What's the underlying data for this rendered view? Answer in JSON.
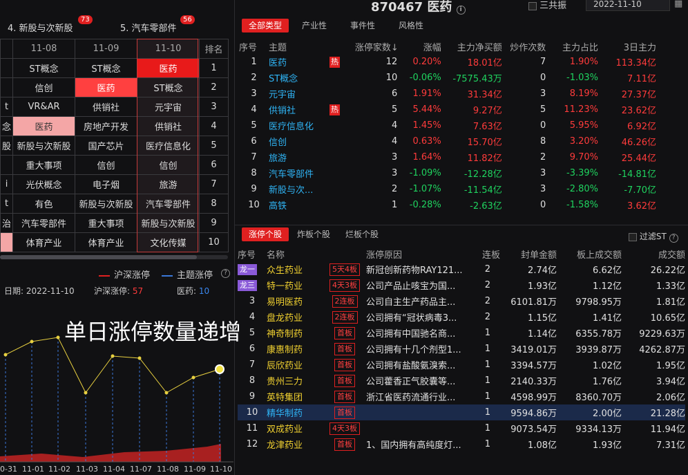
{
  "left": {
    "tabs": [
      {
        "label": "4. 新股与次新股",
        "badge": "73"
      },
      {
        "label": "5. 汽车零部件",
        "badge": "56"
      }
    ],
    "grid": {
      "headers": [
        "",
        "11-08",
        "11-09",
        "11-10",
        "排名"
      ],
      "rows": [
        [
          "",
          "ST概念",
          "ST概念",
          "医药",
          "1"
        ],
        [
          "",
          "信创",
          "医药",
          "ST概念",
          "2"
        ],
        [
          "t",
          "VR&AR",
          "供销社",
          "元宇宙",
          "3"
        ],
        [
          "念",
          "医药",
          "房地产开发",
          "供销社",
          "4"
        ],
        [
          "股",
          "新股与次新股",
          "国产芯片",
          "医疗信息化",
          "5"
        ],
        [
          "",
          "重大事项",
          "信创",
          "信创",
          "6"
        ],
        [
          "i",
          "光伏概念",
          "电子烟",
          "旅游",
          "7"
        ],
        [
          "t",
          "有色",
          "新股与次新股",
          "汽车零部件",
          "8"
        ],
        [
          "治",
          "汽车零部件",
          "重大事项",
          "新股与次新股",
          "9"
        ],
        [
          "",
          "体育产业",
          "体育产业",
          "文化传媒",
          "10"
        ]
      ]
    },
    "legend": {
      "a": "沪深涨停",
      "b": "主题涨停"
    },
    "info": {
      "date_label": "日期:",
      "date": "2022-11-10",
      "hs_label": "沪深涨停:",
      "hs_value": "57",
      "yy_label": "医药:",
      "yy_value": "10"
    },
    "big_text": "单日涨停数量递增",
    "x_labels": [
      "0-31",
      "11-01",
      "11-02",
      "11-03",
      "11-04",
      "11-07",
      "11-08",
      "11-09",
      "11-10"
    ],
    "series_points": [
      8,
      8,
      9,
      9,
      1,
      8,
      8,
      1,
      2,
      2,
      10
    ]
  },
  "right": {
    "code": "870467",
    "name": "医药",
    "sgz_label": "三共振",
    "date": "2022-11-10",
    "tabs1": [
      "全部类型",
      "产业性",
      "事件性",
      "风格性"
    ],
    "t1_headers": [
      "序号",
      "主题",
      "",
      "涨停家数↓",
      "涨幅",
      "主力净买额",
      "炒作次数",
      "主力占比",
      "3日主力"
    ],
    "t1_rows": [
      [
        "1",
        "医药",
        "热",
        "12",
        "0.20%",
        "18.01亿",
        "7",
        "1.90%",
        "113.34亿"
      ],
      [
        "2",
        "ST概念",
        "",
        "10",
        "-0.06%",
        "-7575.43万",
        "0",
        "-1.03%",
        "7.11亿"
      ],
      [
        "3",
        "元宇宙",
        "",
        "6",
        "1.91%",
        "31.34亿",
        "3",
        "8.19%",
        "27.37亿"
      ],
      [
        "4",
        "供销社",
        "热",
        "5",
        "5.44%",
        "9.27亿",
        "5",
        "11.23%",
        "23.62亿"
      ],
      [
        "5",
        "医疗信息化",
        "",
        "4",
        "1.45%",
        "7.63亿",
        "0",
        "5.95%",
        "6.92亿"
      ],
      [
        "6",
        "信创",
        "",
        "4",
        "0.63%",
        "15.70亿",
        "8",
        "3.20%",
        "46.26亿"
      ],
      [
        "7",
        "旅游",
        "",
        "3",
        "1.64%",
        "11.82亿",
        "2",
        "9.70%",
        "25.44亿"
      ],
      [
        "8",
        "汽车零部件",
        "",
        "3",
        "-1.09%",
        "-12.28亿",
        "3",
        "-3.39%",
        "-14.81亿"
      ],
      [
        "9",
        "新股与次...",
        "",
        "2",
        "-1.07%",
        "-11.54亿",
        "3",
        "-2.80%",
        "-7.70亿"
      ],
      [
        "10",
        "高铁",
        "",
        "1",
        "-0.28%",
        "-2.63亿",
        "0",
        "-1.58%",
        "3.62亿"
      ]
    ],
    "tabs2": [
      "涨停个股",
      "炸板个股",
      "烂板个股"
    ],
    "filter_label": "过滤ST",
    "t2_headers": [
      "序号",
      "名称",
      "",
      "涨停原因",
      "连板",
      "封单金额",
      "板上成交额",
      "成交额"
    ],
    "t2_rows": [
      [
        "龙一",
        "众生药业",
        "5天4板",
        "新冠创新药物RAY121...",
        "2",
        "2.74亿",
        "6.62亿",
        "26.22亿"
      ],
      [
        "龙三",
        "特一药业",
        "4天3板",
        "公司产品止咳宝为国...",
        "2",
        "1.93亿",
        "1.12亿",
        "1.33亿"
      ],
      [
        "3",
        "易明医药",
        "2连板",
        "公司自主生产药品主...",
        "2",
        "6101.81万",
        "9798.95万",
        "1.81亿"
      ],
      [
        "4",
        "盘龙药业",
        "2连板",
        "公司拥有“冠状病毒3...",
        "2",
        "1.15亿",
        "1.41亿",
        "10.65亿"
      ],
      [
        "5",
        "神奇制药",
        "首板",
        "公司拥有中国驰名商...",
        "1",
        "1.14亿",
        "6355.78万",
        "9229.63万"
      ],
      [
        "6",
        "康惠制药",
        "首板",
        "公司拥有十几个剂型1...",
        "1",
        "3419.01万",
        "3939.87万",
        "4262.87万"
      ],
      [
        "7",
        "辰欣药业",
        "首板",
        "公司拥有盐酸氨溴索...",
        "1",
        "3394.57万",
        "1.02亿",
        "1.95亿"
      ],
      [
        "8",
        "贵州三力",
        "首板",
        "公司藿香正气胶囊等...",
        "1",
        "2140.33万",
        "1.76亿",
        "3.94亿"
      ],
      [
        "9",
        "英特集团",
        "首板",
        "浙江省医药流通行业...",
        "1",
        "4598.99万",
        "8360.70万",
        "2.06亿"
      ],
      [
        "10",
        "精华制药",
        "首板",
        "",
        "1",
        "9594.86万",
        "2.00亿",
        "21.28亿"
      ],
      [
        "11",
        "双成药业",
        "4天3板",
        "",
        "1",
        "9073.54万",
        "9334.13万",
        "11.94亿"
      ],
      [
        "12",
        "龙津药业",
        "首板",
        "1、国内拥有高纯度灯...",
        "1",
        "1.08亿",
        "1.93亿",
        "7.31亿"
      ]
    ]
  },
  "colors": {
    "red": "#ff3b3b",
    "green": "#1fd35f",
    "cyan": "#2fb4f5",
    "yellow": "#f0d030",
    "accent": "#e02020"
  }
}
